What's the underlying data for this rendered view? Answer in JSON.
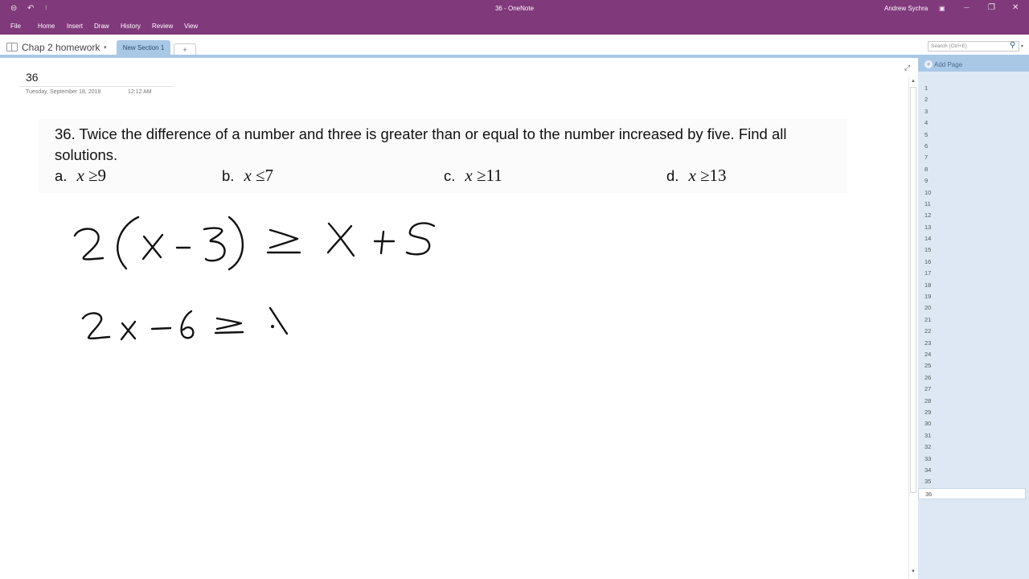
{
  "window": {
    "title": "36  -  OneNote",
    "user": "Andrew Sychra",
    "quick_access": {
      "back_icon": "⊖",
      "undo_icon": "↶",
      "customize_icon": "⁝"
    },
    "controls": {
      "ribbon_display_icon": "▣",
      "minimize_icon": "—",
      "restore_icon": "❐",
      "close_icon": "✕"
    }
  },
  "menu": [
    "File",
    "Home",
    "Insert",
    "Draw",
    "History",
    "Review",
    "View"
  ],
  "notebook": {
    "name": "Chap 2 homework",
    "caret": "▾",
    "sections": [
      {
        "label": "New Section 1",
        "active": true
      }
    ],
    "add_section_label": "+"
  },
  "search": {
    "placeholder": "Search (Ctrl+E)",
    "icon": "⚲",
    "dropdown_icon": "▾"
  },
  "page": {
    "title": "36",
    "date": "Tuesday, September 18, 2018",
    "time": "12:12 AM",
    "expand_icon": "⤢",
    "problem": {
      "text": "36.  Twice the difference of a number and three is greater than or equal to the number increased by five.  Find all solutions.",
      "choices": [
        {
          "label": "a.",
          "var": "x",
          "op": "≥",
          "value": "9"
        },
        {
          "label": "b.",
          "var": "x",
          "op": "≤",
          "value": "7"
        },
        {
          "label": "c.",
          "var": "x",
          "op": "≥",
          "value": "11"
        },
        {
          "label": "d.",
          "var": "x",
          "op": "≥",
          "value": "13"
        }
      ]
    },
    "handwriting": [
      "2(x - 3) ≥ x + 5",
      "2x - 6 ≥ \\"
    ]
  },
  "page_pane": {
    "add_page_label": "Add Page",
    "pages": [
      "1",
      "2",
      "3",
      "4",
      "5",
      "6",
      "7",
      "8",
      "9",
      "10",
      "11",
      "12",
      "13",
      "14",
      "15",
      "16",
      "17",
      "18",
      "19",
      "20",
      "21",
      "22",
      "23",
      "24",
      "25",
      "26",
      "27",
      "28",
      "29",
      "30",
      "31",
      "32",
      "33",
      "34",
      "35",
      "36"
    ],
    "selected": "36"
  },
  "scrollbar": {
    "up_icon": "▲",
    "down_icon": "▼"
  }
}
